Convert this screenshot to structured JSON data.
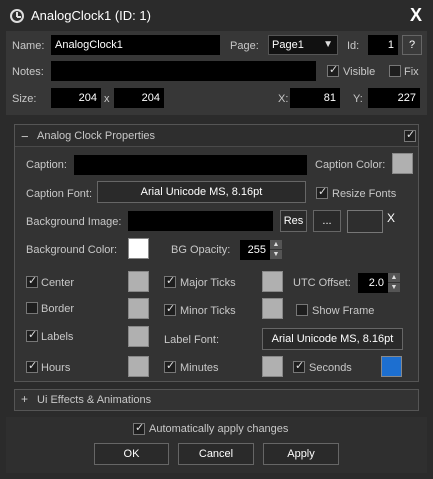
{
  "window": {
    "title": "AnalogClock1 (ID: 1)",
    "close": "X"
  },
  "header": {
    "name_label": "Name:",
    "name_value": "AnalogClock1",
    "page_label": "Page:",
    "page_value": "Page1",
    "id_label": "Id:",
    "id_value": "1",
    "help_label": "?",
    "notes_label": "Notes:",
    "notes_value": "",
    "visible_label": "Visible",
    "visible_checked": true,
    "fix_label": "Fix",
    "fix_checked": false,
    "size_label": "Size:",
    "width": "204",
    "x_sep": "x",
    "height": "204",
    "x_label": "X:",
    "x_value": "81",
    "y_label": "Y:",
    "y_value": "227"
  },
  "props": {
    "title": "Analog Clock Properties",
    "collapse": "−",
    "caption_label": "Caption:",
    "caption_value": "",
    "caption_color_label": "Caption Color:",
    "caption_font_label": "Caption Font:",
    "caption_font_value": "Arial Unicode MS, 8.16pt",
    "resize_fonts_label": "Resize Fonts",
    "bg_image_label": "Background Image:",
    "bg_image_value": "",
    "res_label": "Res",
    "browse_label": "...",
    "clear_label": "X",
    "bg_color_label": "Background Color:",
    "bg_opacity_label": "BG Opacity:",
    "bg_opacity_value": "255",
    "center_label": "Center",
    "border_label": "Border",
    "labels_label": "Labels",
    "hours_label": "Hours",
    "major_ticks_label": "Major Ticks",
    "minor_ticks_label": "Minor Ticks",
    "minutes_label": "Minutes",
    "label_font_label": "Label Font:",
    "label_font_value": "Arial Unicode MS, 8.16pt",
    "utc_offset_label": "UTC Offset:",
    "utc_offset_value": "2.0",
    "show_frame_label": "Show Frame",
    "seconds_label": "Seconds"
  },
  "effects": {
    "title": "Ui Effects & Animations",
    "expand": "+"
  },
  "footer": {
    "auto_apply_label": "Automatically apply changes",
    "ok": "OK",
    "cancel": "Cancel",
    "apply": "Apply"
  },
  "colors": {
    "accent": "#1d6fd0",
    "swatch_gray": "#b0b0b0",
    "bg_white": "#ffffff"
  }
}
